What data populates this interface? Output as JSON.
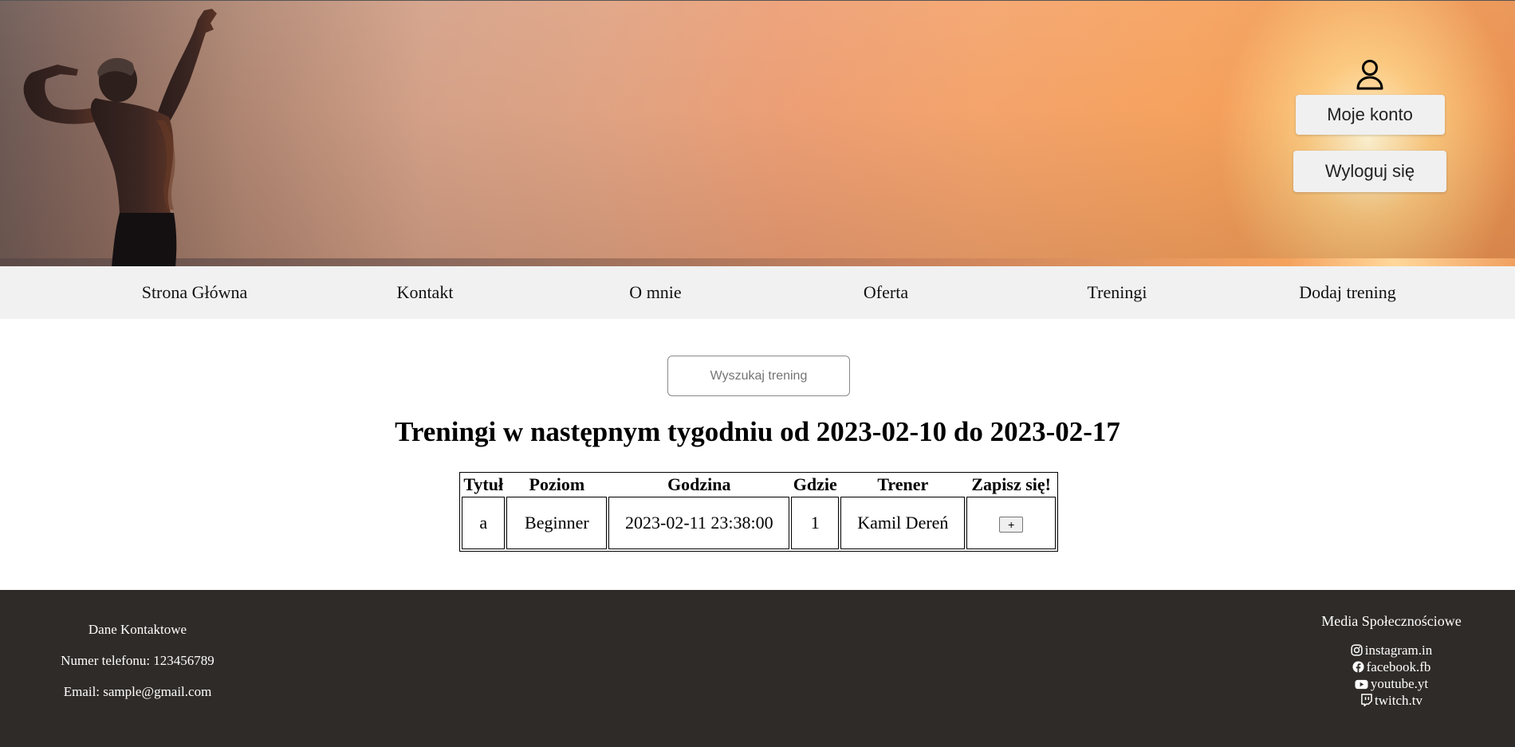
{
  "header": {
    "account_button": "Moje konto",
    "logout_button": "Wyloguj się"
  },
  "nav": {
    "items": [
      {
        "label": "Strona Główna"
      },
      {
        "label": "Kontakt"
      },
      {
        "label": "O mnie"
      },
      {
        "label": "Oferta"
      },
      {
        "label": "Treningi"
      },
      {
        "label": "Dodaj trening"
      }
    ]
  },
  "search": {
    "placeholder": "Wyszukaj trening",
    "value": ""
  },
  "main": {
    "title": "Treningi w następnym tygodniu od 2023-02-10 do 2023-02-17"
  },
  "table": {
    "headers": [
      "Tytuł",
      "Poziom",
      "Godzina",
      "Gdzie",
      "Trener",
      "Zapisz się!"
    ],
    "rows": [
      {
        "title": "a",
        "level": "Beginner",
        "time": "2023-02-11 23:38:00",
        "where": "1",
        "trainer": "Kamil Dereń",
        "signup_button": "+"
      }
    ]
  },
  "footer": {
    "contact": {
      "heading": "Dane Kontaktowe",
      "phone": "Numer telefonu: 123456789",
      "email": "Email: sample@gmail.com"
    },
    "social": {
      "heading": "Media Społecznościowe",
      "links": [
        {
          "icon": "instagram-icon",
          "label": "instagram.in"
        },
        {
          "icon": "facebook-icon",
          "label": "facebook.fb"
        },
        {
          "icon": "youtube-icon",
          "label": "youtube.yt"
        },
        {
          "icon": "twitch-icon",
          "label": "twitch.tv"
        }
      ]
    }
  },
  "colors": {
    "footer_bg": "#2f2b28",
    "nav_bg": "#f1f1f1",
    "hero_sky": "#f4a46c"
  }
}
